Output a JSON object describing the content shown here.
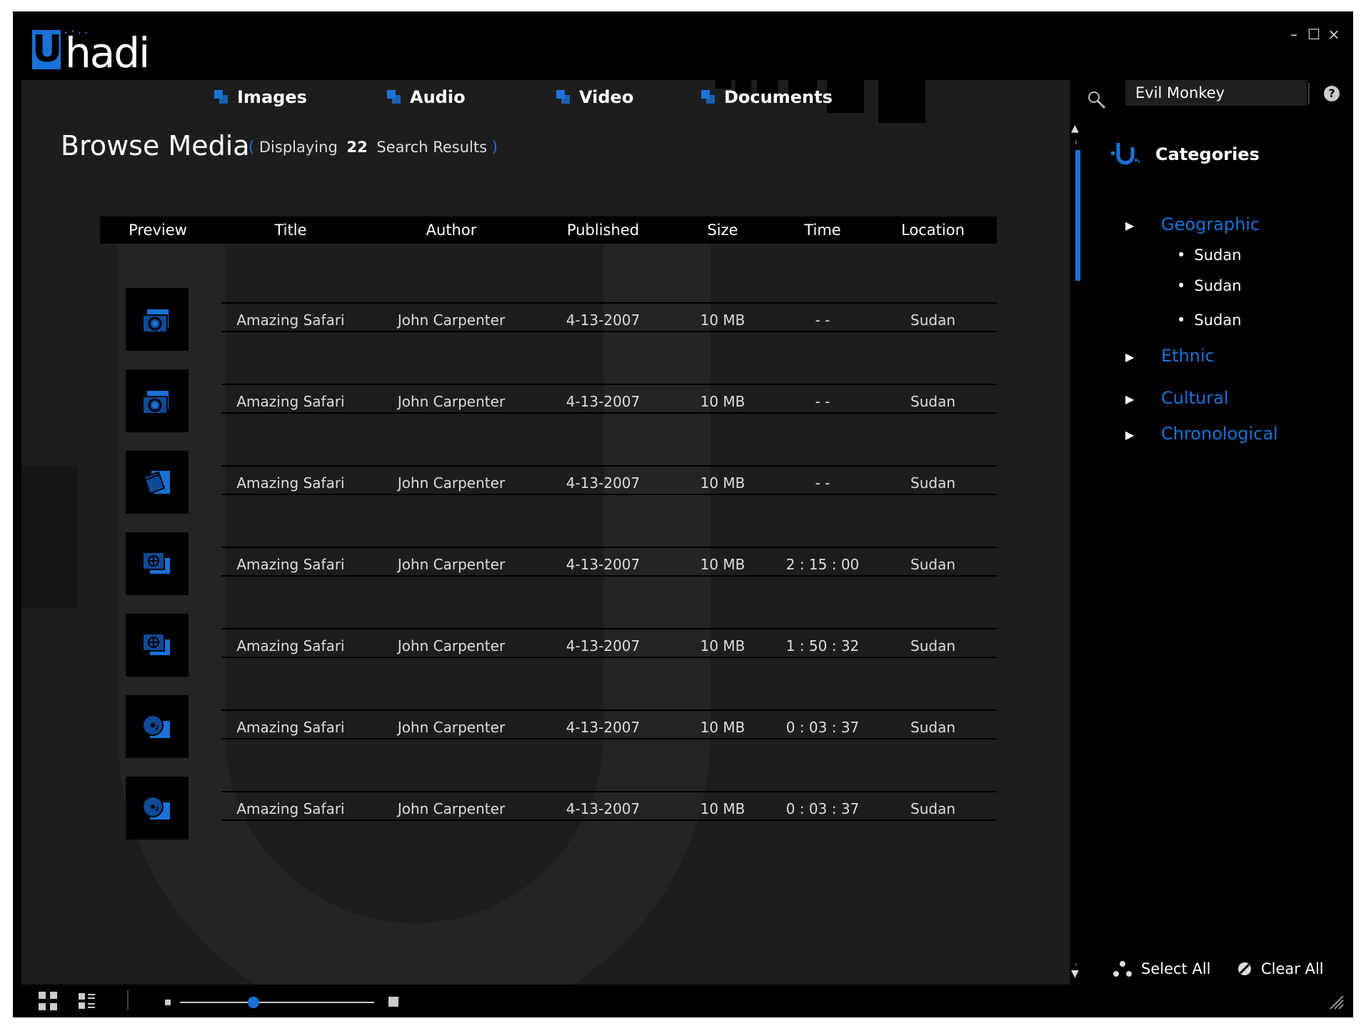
{
  "app": {
    "logo_u": "U",
    "logo_rest": "hadi"
  },
  "window_controls": {
    "minimize": "–",
    "maximize": "☐",
    "close": "×"
  },
  "tabs": [
    {
      "label": "Images"
    },
    {
      "label": "Audio"
    },
    {
      "label": "Video"
    },
    {
      "label": "Documents"
    }
  ],
  "page": {
    "title": "Browse Media",
    "displaying_label": "Displaying",
    "result_count": "22",
    "results_label": "Search Results"
  },
  "table": {
    "columns": [
      "Preview",
      "Title",
      "Author",
      "Published",
      "Size",
      "Time",
      "Location"
    ],
    "rows": [
      {
        "icon": "camera-icon",
        "title": "Amazing Safari",
        "author": "John Carpenter",
        "published": "4-13-2007",
        "size": "10 MB",
        "time": "- -",
        "location": "Sudan"
      },
      {
        "icon": "camera-icon",
        "title": "Amazing Safari",
        "author": "John Carpenter",
        "published": "4-13-2007",
        "size": "10 MB",
        "time": "- -",
        "location": "Sudan"
      },
      {
        "icon": "document-icon",
        "title": "Amazing Safari",
        "author": "John Carpenter",
        "published": "4-13-2007",
        "size": "10 MB",
        "time": "- -",
        "location": "Sudan"
      },
      {
        "icon": "film-icon",
        "title": "Amazing Safari",
        "author": "John Carpenter",
        "published": "4-13-2007",
        "size": "10 MB",
        "time": "2 : 15 : 00",
        "location": "Sudan"
      },
      {
        "icon": "film-icon",
        "title": "Amazing Safari",
        "author": "John Carpenter",
        "published": "4-13-2007",
        "size": "10 MB",
        "time": "1 : 50 : 32",
        "location": "Sudan"
      },
      {
        "icon": "music-disc-icon",
        "title": "Amazing Safari",
        "author": "John Carpenter",
        "published": "4-13-2007",
        "size": "10 MB",
        "time": "0 : 03 : 37",
        "location": "Sudan"
      },
      {
        "icon": "music-disc-icon",
        "title": "Amazing Safari",
        "author": "John Carpenter",
        "published": "4-13-2007",
        "size": "10 MB",
        "time": "0 : 03 : 37",
        "location": "Sudan"
      }
    ]
  },
  "search": {
    "value": "Evil Monkey"
  },
  "help_label": "?",
  "sidebar": {
    "categories_label": "Categories",
    "categories": [
      {
        "label": "Geographic",
        "children": [
          "Sudan",
          "Sudan",
          "Sudan"
        ]
      },
      {
        "label": "Ethnic"
      },
      {
        "label": "Cultural"
      },
      {
        "label": "Chronological"
      }
    ],
    "select_all": "Select All",
    "clear_all": "Clear All"
  },
  "zoom_slider": {
    "value_fraction": 0.38
  },
  "colors": {
    "accent": "#1a72d8",
    "panel": "#1d1d1d",
    "background": "#000000"
  }
}
